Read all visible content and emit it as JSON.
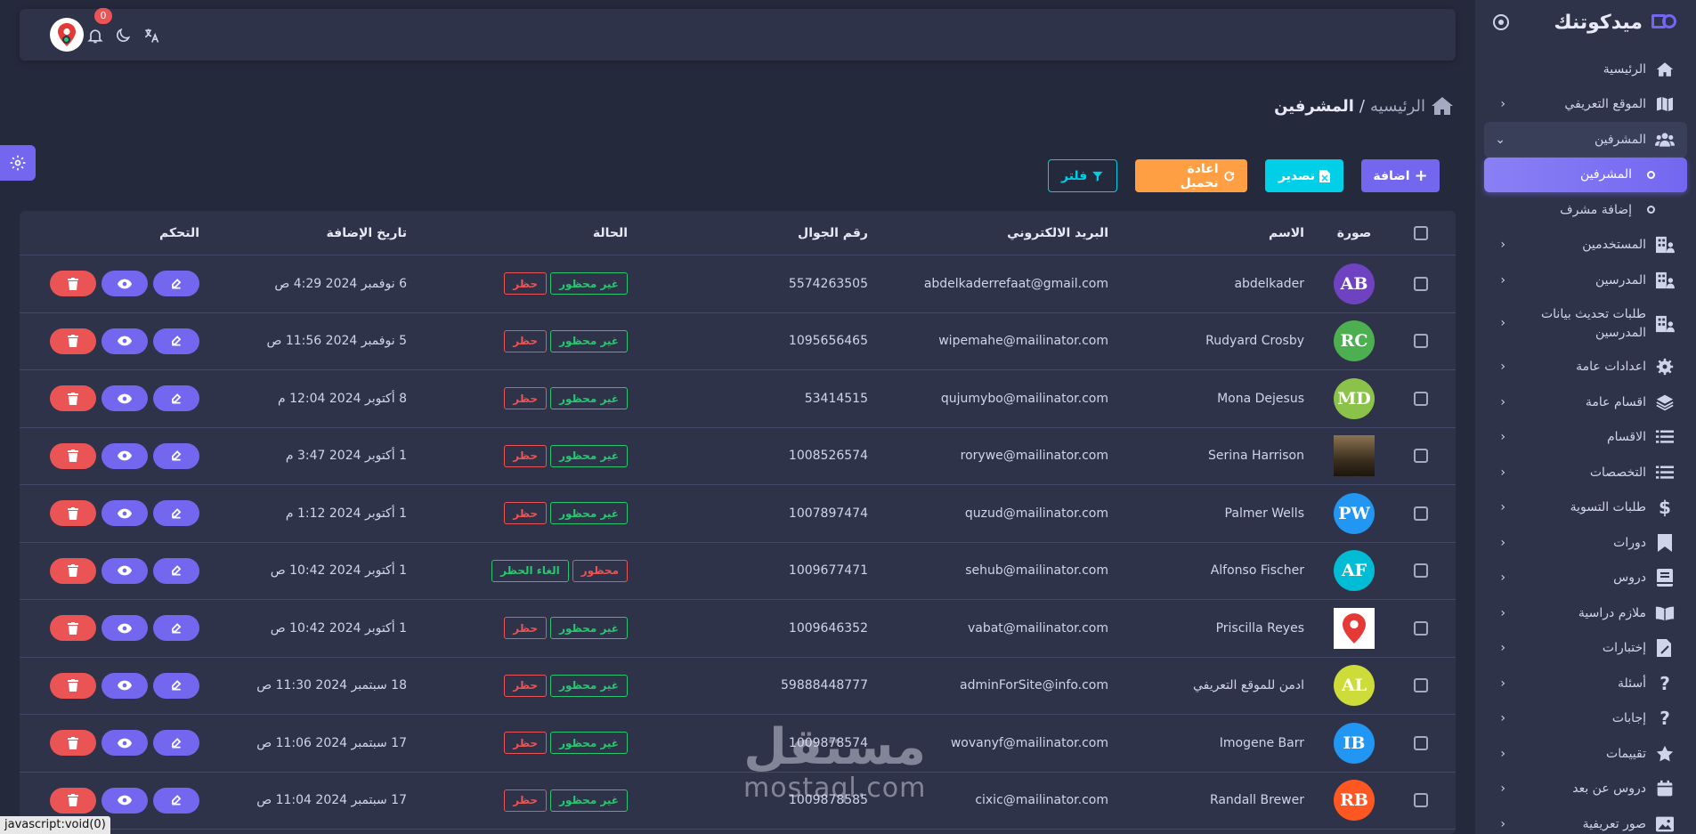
{
  "app": {
    "brand_name": "ميدكوتنك",
    "notification_count": "0",
    "status_bar_text": "javascript:void(0)"
  },
  "sidebar": {
    "items": [
      {
        "label": "الرئيسية",
        "icon": "home-icon",
        "chevron": false
      },
      {
        "label": "الموقع التعريفي",
        "icon": "map-icon",
        "chevron": true
      },
      {
        "label": "المشرفين",
        "icon": "users-group-icon",
        "chevron": true,
        "open": true
      },
      {
        "label": "المشرفين",
        "icon": "circle-bullet-icon",
        "chevron": false,
        "active": true,
        "sub": true
      },
      {
        "label": "إضافة مشرف",
        "icon": "circle-bullet-icon",
        "chevron": false,
        "sub": true
      },
      {
        "label": "المستخدمين",
        "icon": "building-user-icon",
        "chevron": true
      },
      {
        "label": "المدرسين",
        "icon": "building-user-icon",
        "chevron": true
      },
      {
        "label": "طلبات تحديث بيانات المدرسين",
        "icon": "building-user-icon",
        "chevron": true,
        "tall": true
      },
      {
        "label": "اعدادات عامة",
        "icon": "gear-icon",
        "chevron": true
      },
      {
        "label": "اقسام عامة",
        "icon": "layers-icon",
        "chevron": true
      },
      {
        "label": "الاقسام",
        "icon": "list-icon",
        "chevron": true
      },
      {
        "label": "التخصصات",
        "icon": "list-icon",
        "chevron": true
      },
      {
        "label": "طلبات التسوية",
        "icon": "dollar-icon",
        "chevron": true
      },
      {
        "label": "دورات",
        "icon": "bookmark-icon",
        "chevron": true
      },
      {
        "label": "دروس",
        "icon": "book-icon",
        "chevron": true
      },
      {
        "label": "ملازم دراسية",
        "icon": "open-book-icon",
        "chevron": true
      },
      {
        "label": "إختبارات",
        "icon": "file-pen-icon",
        "chevron": true
      },
      {
        "label": "أسئلة",
        "icon": "question-icon",
        "chevron": true
      },
      {
        "label": "إجابات",
        "icon": "question-icon",
        "chevron": true
      },
      {
        "label": "تقييمات",
        "icon": "star-icon",
        "chevron": true
      },
      {
        "label": "دروس عن بعد",
        "icon": "calendar-icon",
        "chevron": true
      },
      {
        "label": "صور تعريفية",
        "icon": "image-icon",
        "chevron": true
      }
    ]
  },
  "breadcrumb": {
    "home": "الرئيسيه",
    "separator": "/",
    "current": "المشرفين"
  },
  "actions": {
    "add": "اضافة",
    "export": "تصدير",
    "reload": "اعادة تحميل",
    "filter": "فلتر"
  },
  "table": {
    "headers": {
      "image": "صورة",
      "name": "الاسم",
      "email": "البريد الالكتروني",
      "phone": "رقم الجوال",
      "status": "الحالة",
      "date": "تاريخ الإضافة",
      "control": "التحكم"
    },
    "rows": [
      {
        "initials": "AB",
        "avatar_color": "#6f42c1",
        "name": "abdelkader",
        "email": "abdelkaderrefaat@gmail.com",
        "phone": "5574263505",
        "status": "غير محظور",
        "action": "حظر",
        "banned": false,
        "date": "6 نوفمبر 2024 4:29 ص"
      },
      {
        "initials": "RC",
        "avatar_color": "#4caf50",
        "name": "Rudyard Crosby",
        "email": "wipemahe@mailinator.com",
        "phone": "1095656465",
        "status": "غير محظور",
        "action": "حظر",
        "banned": false,
        "date": "5 نوفمبر 2024 11:56 ص"
      },
      {
        "initials": "MD",
        "avatar_color": "#8bc34a",
        "name": "Mona Dejesus",
        "email": "qujumybo@mailinator.com",
        "phone": "53414515",
        "status": "غير محظور",
        "action": "حظر",
        "banned": false,
        "date": "8 أكتوبر 2024 12:04 م"
      },
      {
        "initials": "",
        "avatar_color": "#6b5a3a",
        "photo": "photo",
        "name": "Serina Harrison",
        "email": "rorywe@mailinator.com",
        "phone": "1008526574",
        "status": "غير محظور",
        "action": "حظر",
        "banned": false,
        "date": "1 أكتوبر 2024 3:47 م"
      },
      {
        "initials": "PW",
        "avatar_color": "#2196f3",
        "name": "Palmer Wells",
        "email": "quzud@mailinator.com",
        "phone": "1007897474",
        "status": "غير محظور",
        "action": "حظر",
        "banned": false,
        "date": "1 أكتوبر 2024 1:12 م"
      },
      {
        "initials": "AF",
        "avatar_color": "#00bcd4",
        "name": "Alfonso Fischer",
        "email": "sehub@mailinator.com",
        "phone": "1009677471",
        "status": "محظور",
        "action": "الغاء الحظر",
        "banned": true,
        "date": "1 أكتوبر 2024 10:42 ص"
      },
      {
        "initials": "",
        "avatar_color": "#ffffff",
        "photo": "map-pin",
        "name": "Priscilla Reyes",
        "email": "vabat@mailinator.com",
        "phone": "1009646352",
        "status": "غير محظور",
        "action": "حظر",
        "banned": false,
        "date": "1 أكتوبر 2024 10:42 ص"
      },
      {
        "initials": "AL",
        "avatar_color": "#cddc39",
        "name": "ادمن للموقع التعريفي",
        "email": "adminForSite@info.com",
        "phone": "59888448777",
        "status": "غير محظور",
        "action": "حظر",
        "banned": false,
        "date": "18 سبتمبر 2024 11:30 ص"
      },
      {
        "initials": "IB",
        "avatar_color": "#2196f3",
        "name": "Imogene Barr",
        "email": "wovanyf@mailinator.com",
        "phone": "1009878574",
        "status": "غير محظور",
        "action": "حظر",
        "banned": false,
        "date": "17 سبتمبر 2024 11:06 ص"
      },
      {
        "initials": "RB",
        "avatar_color": "#ff5722",
        "name": "Randall Brewer",
        "email": "cixic@mailinator.com",
        "phone": "1009878585",
        "status": "غير محظور",
        "action": "حظر",
        "banned": false,
        "date": "17 سبتمبر 2024 11:04 ص"
      }
    ]
  },
  "watermark": {
    "arabic": "مستقل",
    "latin": "mostaql.com"
  },
  "colors": {
    "primary": "#7367f0",
    "info": "#00cfe8",
    "warning": "#ff9f43",
    "success": "#28c76f",
    "danger": "#ea5455"
  }
}
